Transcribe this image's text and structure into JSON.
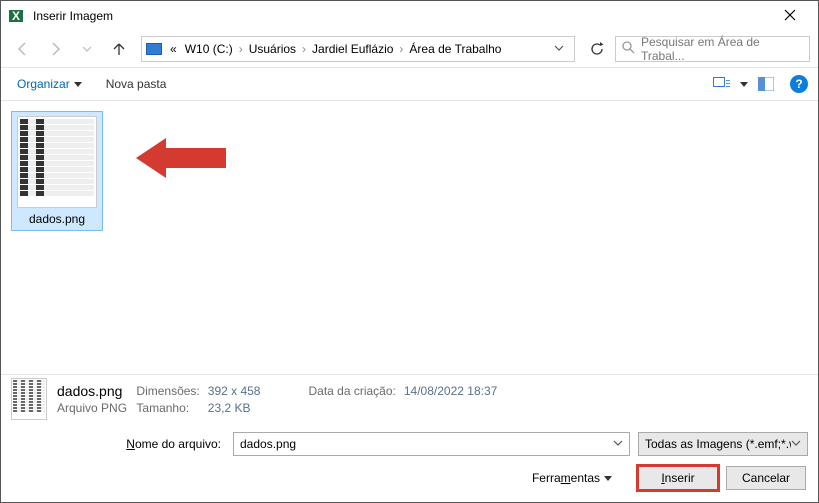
{
  "window": {
    "title": "Inserir Imagem"
  },
  "breadcrumb": {
    "prefix": "«",
    "items": [
      "W10 (C:)",
      "Usuários",
      "Jardiel Euflázio",
      "Área de Trabalho"
    ]
  },
  "search": {
    "placeholder": "Pesquisar em Área de Trabal..."
  },
  "toolbar": {
    "organize": "Organizar",
    "newfolder": "Nova pasta"
  },
  "files": [
    {
      "name": "dados.png",
      "selected": true
    }
  ],
  "details": {
    "filename": "dados.png",
    "type": "Arquivo PNG",
    "dim_label": "Dimensões:",
    "dim_value": "392 x 458",
    "size_label": "Tamanho:",
    "size_value": "23,2 KB",
    "created_label": "Data da criação:",
    "created_value": "14/08/2022 18:37"
  },
  "footer": {
    "filename_label_pre": "",
    "filename_label_u": "N",
    "filename_label_post": "ome do arquivo:",
    "filename_value": "dados.png",
    "filter": "Todas as Imagens (*.emf;*.wmf,",
    "tools_pre": "Ferra",
    "tools_u": "m",
    "tools_post": "entas",
    "insert_u": "I",
    "insert_post": "nserir",
    "cancel": "Cancelar"
  }
}
